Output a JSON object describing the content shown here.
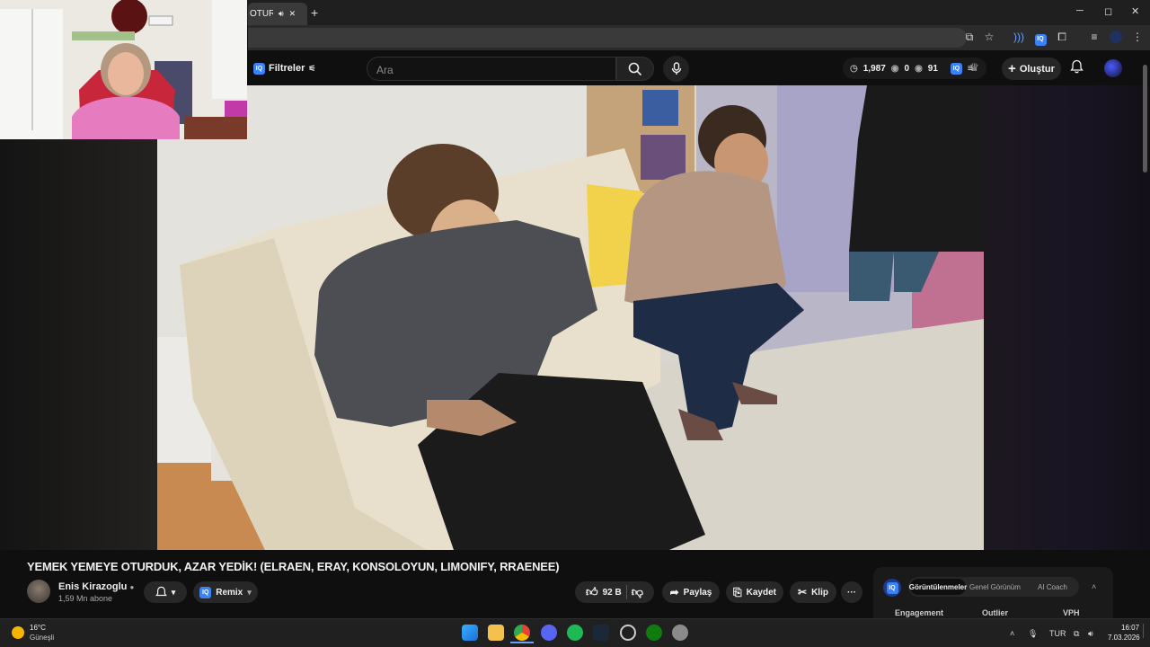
{
  "browser": {
    "tab_title": "OTURDUK,",
    "new_tab": "+",
    "win_min": "─",
    "win_max": "◻",
    "win_close": "✕"
  },
  "yt": {
    "filters_label": "Filtreler",
    "search_placeholder": "Ara",
    "stat_views": "1,987",
    "stat_a": "0",
    "stat_b": "91",
    "create_label": "Oluştur"
  },
  "video": {
    "title": "YEMEK YEMEYE OTURDUK, AZAR YEDİK! (ELRAEN, ERAY, KONSOLOYUN, LIMONIFY, RRAENEE)",
    "channel_name": "Enis Kirazoglu",
    "subscribers": "1,59 Mn abone",
    "remix_label": "Remix",
    "likes": "92 B",
    "share_label": "Paylaş",
    "save_label": "Kaydet",
    "clip_label": "Klip",
    "more": "···"
  },
  "side_panel": {
    "tabs": [
      "Görüntülenmeler",
      "Genel Görünüm",
      "AI Coach"
    ],
    "columns": [
      "Engagement",
      "Outlier",
      "VPH"
    ]
  },
  "taskbar": {
    "temp": "16°C",
    "weather": "Güneşli",
    "lang": "TUR",
    "time": "16:07",
    "date": "7.03.2026"
  },
  "colors": {
    "accent": "#3b82f6",
    "bg": "#0f0f0f"
  }
}
